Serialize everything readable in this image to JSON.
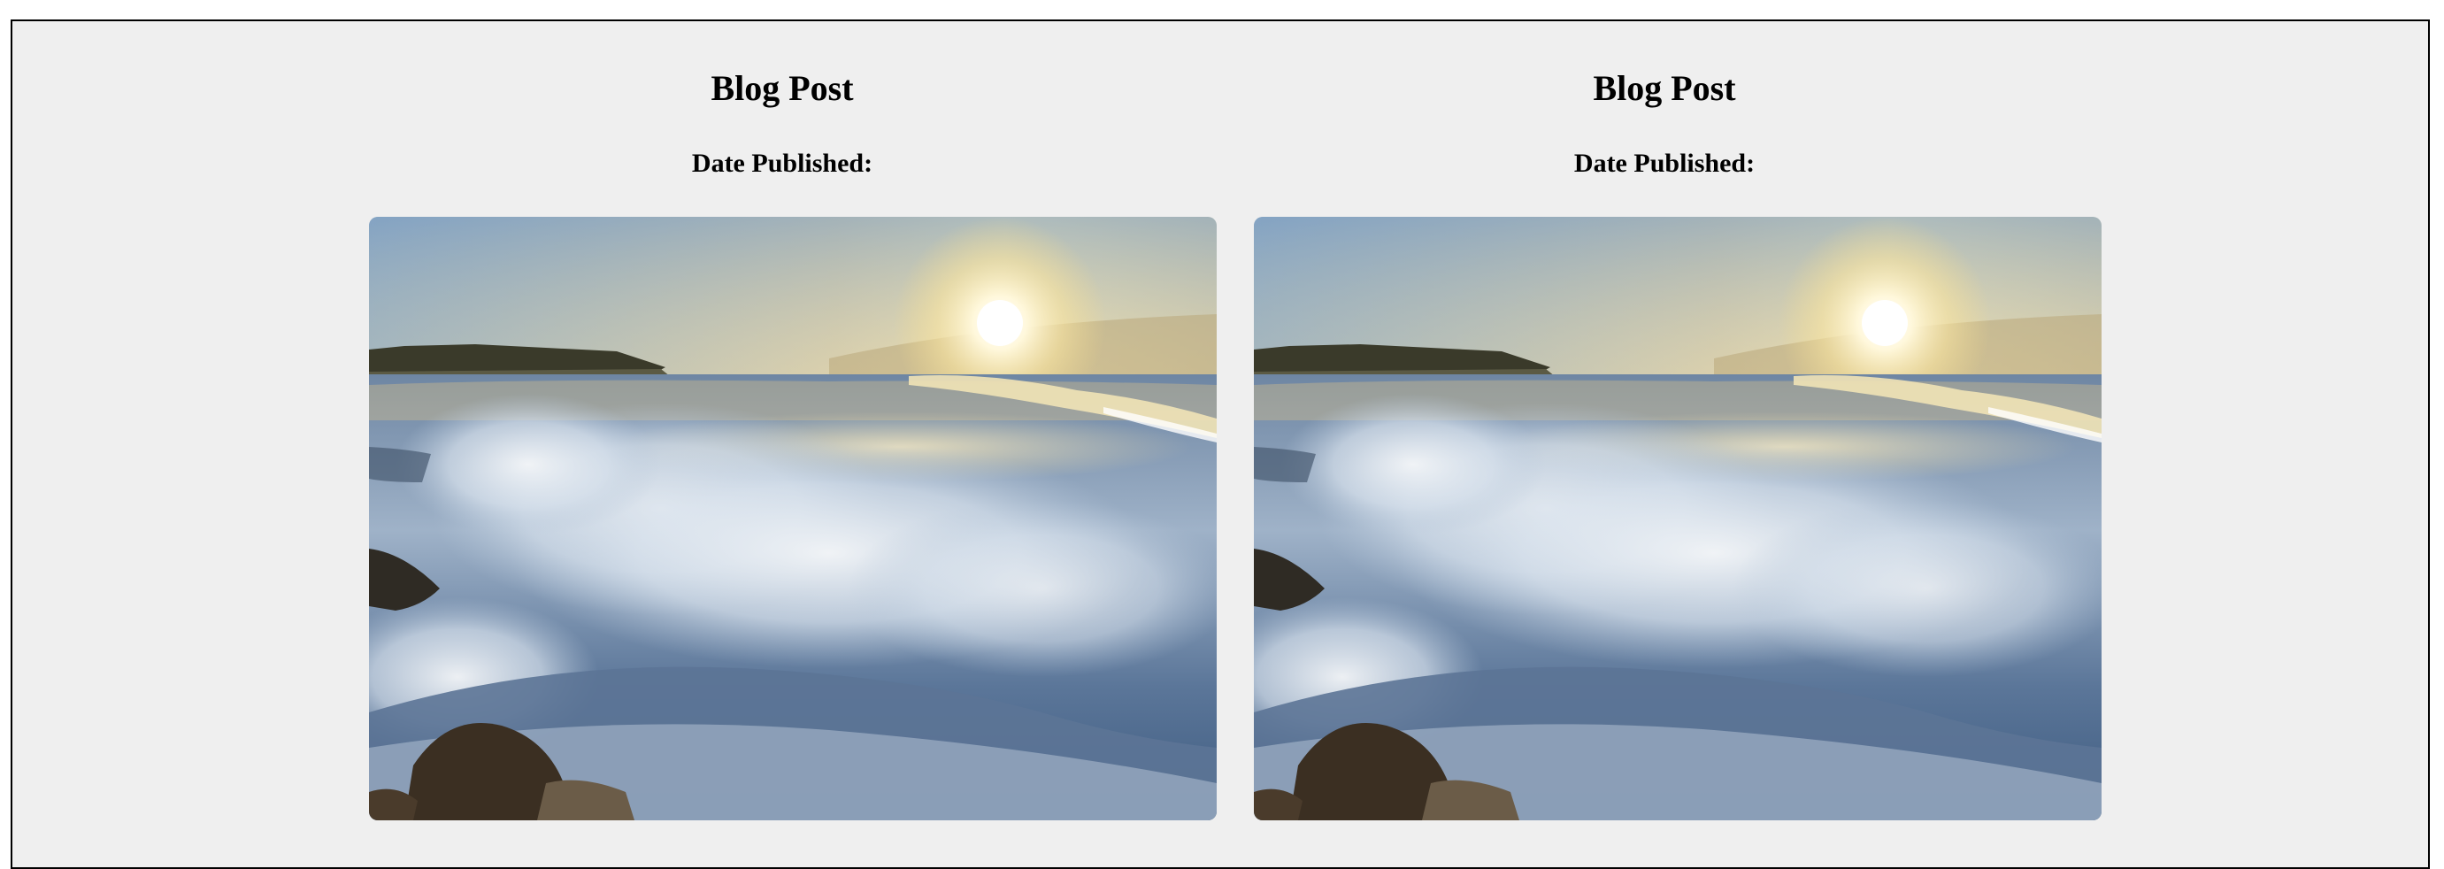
{
  "posts": [
    {
      "title": "Blog Post",
      "date_label": "Date Published:",
      "image": "ocean-waves-sunrise-photo"
    },
    {
      "title": "Blog Post",
      "date_label": "Date Published:",
      "image": "ocean-waves-sunrise-photo"
    }
  ],
  "colors": {
    "page_background": "#efefef",
    "border": "#000000",
    "sky_top": "#8fb0cf",
    "sun_glow": "#fff3c4",
    "water": "#3d5f86",
    "foam": "#e6eef6"
  }
}
